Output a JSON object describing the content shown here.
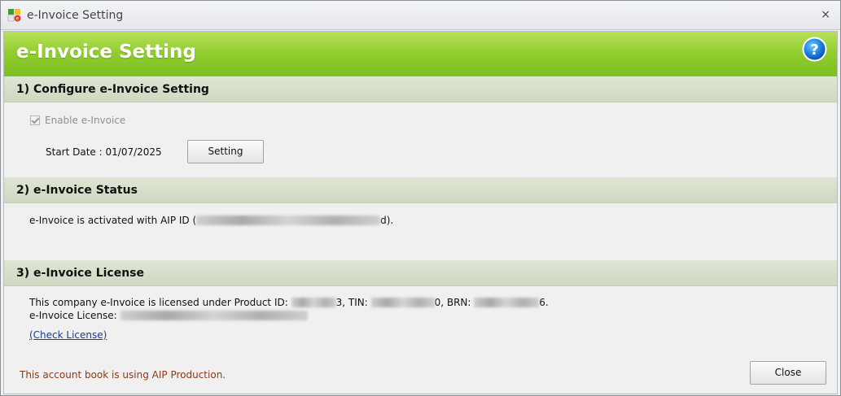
{
  "window": {
    "title": "e-Invoice Setting",
    "close_glyph": "×"
  },
  "banner": {
    "title": "e-Invoice Setting",
    "help_icon": "help-icon"
  },
  "section1": {
    "header": "1) Configure e-Invoice Setting",
    "enable_label": "Enable e-Invoice",
    "enable_checked": true,
    "start_date_label": "Start Date :",
    "start_date_value": "01/07/2025",
    "setting_button": "Setting"
  },
  "section2": {
    "header": "2) e-Invoice Status",
    "status_prefix": "e-Invoice is activated with AIP ID (",
    "status_suffix": "d)."
  },
  "section3": {
    "header": "3) e-Invoice License",
    "licensed_prefix": "This company e-Invoice is licensed under Product ID:",
    "pid_suffix": "3, TIN:",
    "tin_suffix": "0, BRN:",
    "brn_suffix": "6.",
    "license_label": "e-Invoice License:",
    "check_license": "(Check License)"
  },
  "footer": {
    "note": "This account book is using AIP Production.",
    "close_button": "Close"
  },
  "colors": {
    "banner_green": "#8fcd2d",
    "section_header_bg": "#d6decb",
    "link": "#1a3d8f",
    "footer_note": "#8a3b12"
  }
}
